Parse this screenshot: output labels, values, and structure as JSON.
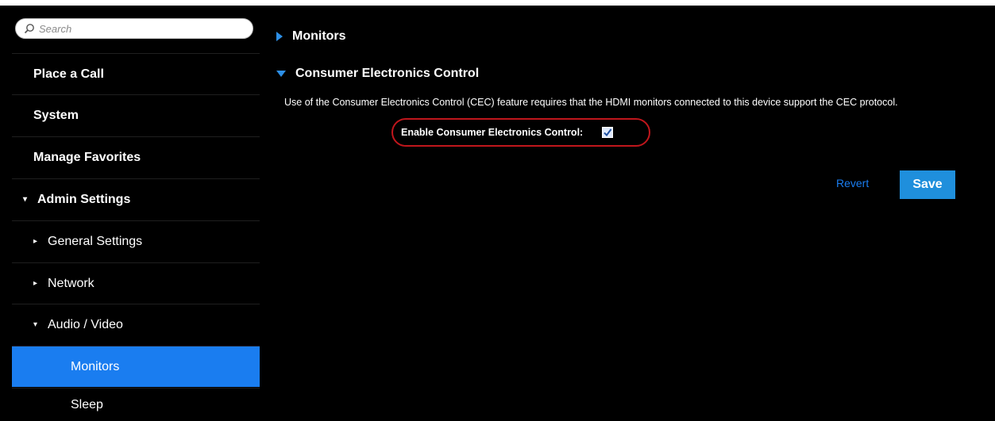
{
  "search": {
    "placeholder": "Search"
  },
  "sidebar": {
    "items": [
      {
        "label": "Place a Call"
      },
      {
        "label": "System"
      },
      {
        "label": "Manage Favorites"
      },
      {
        "label": "Admin Settings",
        "caret": "▾"
      },
      {
        "label": "General Settings",
        "caret": "▸"
      },
      {
        "label": "Network",
        "caret": "▸"
      },
      {
        "label": "Audio / Video",
        "caret": "▾"
      },
      {
        "label": "Monitors"
      },
      {
        "label": "Sleep"
      }
    ]
  },
  "main": {
    "sections": [
      {
        "title": "Monitors"
      },
      {
        "title": "Consumer Electronics Control"
      }
    ],
    "cec": {
      "description": "Use of the Consumer Electronics Control (CEC) feature requires that the HDMI monitors connected to this device support the CEC protocol.",
      "enable_label": "Enable Consumer Electronics Control:",
      "enabled": true
    },
    "actions": {
      "revert_label": "Revert",
      "save_label": "Save"
    }
  },
  "colors": {
    "accent": "#1a7df0",
    "highlight_border": "#c0161c",
    "background": "#000000"
  }
}
